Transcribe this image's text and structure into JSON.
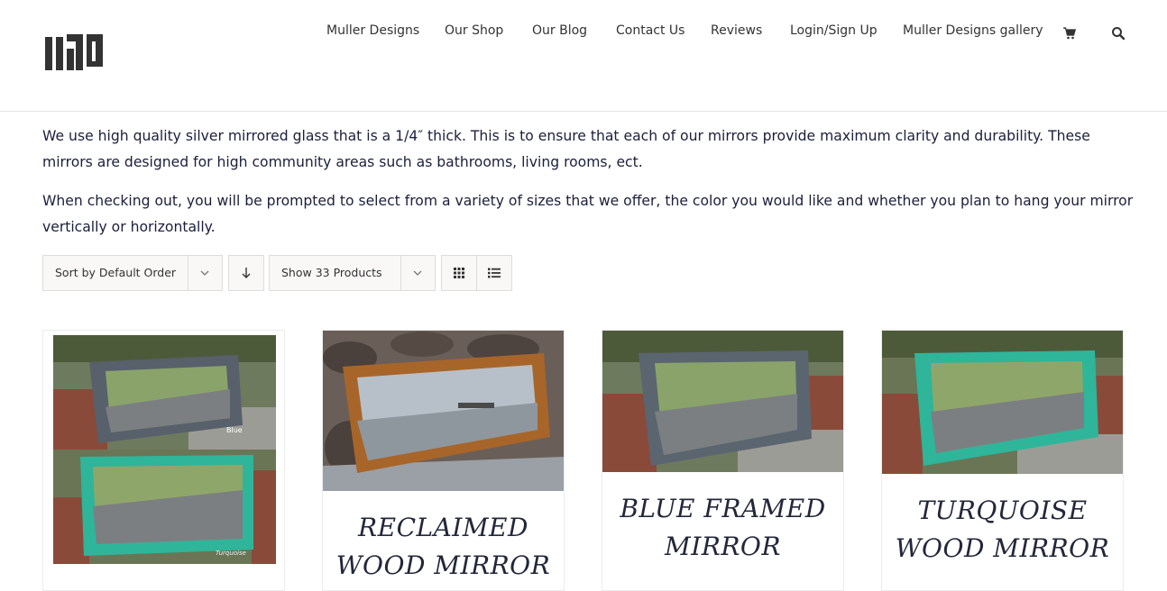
{
  "nav": {
    "items": [
      "Muller Designs",
      "Our Shop",
      "Our Blog",
      "Contact Us",
      "Reviews",
      "Login/Sign Up",
      "Muller Designs gallery"
    ],
    "cart_icon": "cart-icon",
    "search_icon": "search-icon"
  },
  "intro": {
    "p1": "We use high quality silver mirrored glass that is a 1/4″ thick. This is to ensure that each of our mirrors provide maximum clarity and durability. These mirrors are designed for high community areas such as bathrooms, living rooms, ect.",
    "p2": "When checking out, you will be prompted to select from a variety of sizes that we offer, the color you would like and whether you plan to hang your mirror vertically or horizontally."
  },
  "toolbar": {
    "sort_label": "Sort by Default Order",
    "show_label": "Show 33 Products",
    "sort_direction_icon": "arrow-down-icon",
    "grid_icon": "grid-view-icon",
    "list_icon": "list-view-icon"
  },
  "products": [
    {
      "title": "",
      "image_labels": [
        "Blue",
        "Turquoise"
      ]
    },
    {
      "title": "RECLAIMED WOOD MIRROR"
    },
    {
      "title": "BLUE FRAMED MIRROR"
    },
    {
      "title": "TURQUOISE WOOD MIRROR"
    }
  ],
  "colors": {
    "text": "#1b1f3b",
    "border": "#dcdcdc",
    "toolbar_bg": "#f9f8f6"
  }
}
